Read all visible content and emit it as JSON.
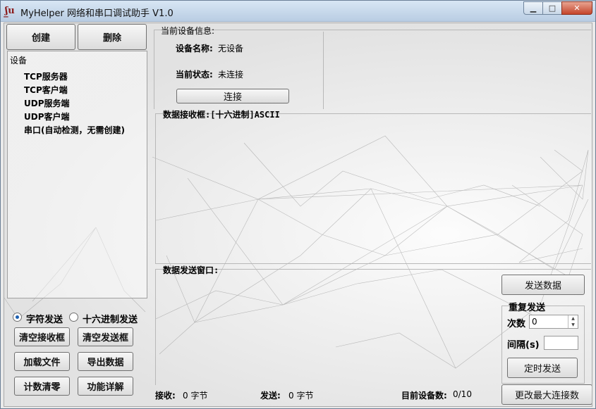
{
  "window": {
    "title": "MyHelper 网络和串口调试助手 V1.0",
    "controls": {
      "minimize": "▁",
      "maximize": "□",
      "close": "✕"
    }
  },
  "left": {
    "create_label": "创建",
    "delete_label": "删除",
    "list_header": "设备",
    "devices": [
      "TCP服务器",
      "TCP客户端",
      "UDP服务端",
      "UDP客户端",
      "串口(自动检测，无需创建)"
    ],
    "radio_char": "字符发送",
    "radio_hex": "十六进制发送",
    "clear_recv": "清空接收框",
    "clear_send": "清空发送框",
    "load_file": "加载文件",
    "export_data": "导出数据",
    "reset_count": "计数清零",
    "feature_detail": "功能详解"
  },
  "device_info": {
    "legend": "当前设备信息:",
    "name_label": "设备名称:",
    "name_value": "无设备",
    "status_label": "当前状态:",
    "status_value": "未连接",
    "connect_label": "连接"
  },
  "receive": {
    "legend": "数据接收框:[十六进制]ASCII"
  },
  "send": {
    "legend": "数据发送窗口:",
    "send_button": "发送数据",
    "repeat_legend": "重复发送",
    "count_label": "次数",
    "count_value": "0",
    "interval_label": "间隔(s)",
    "interval_value": "",
    "timed_send": "定时发送"
  },
  "status": {
    "recv_label": "接收:",
    "recv_value": "0 字节",
    "send_label": "发送:",
    "send_value": "0 字节",
    "device_count_label": "目前设备数:",
    "device_count_value": "0/10",
    "change_max": "更改最大连接数"
  }
}
